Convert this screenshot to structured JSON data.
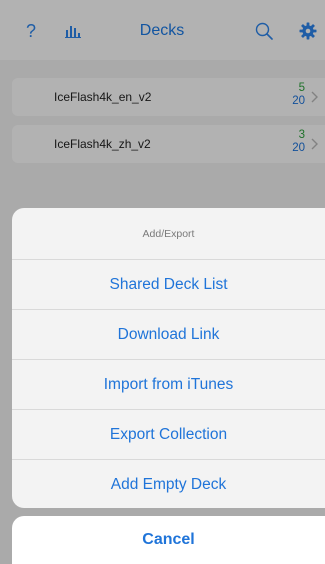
{
  "nav": {
    "help_glyph": "?",
    "title": "Decks",
    "icons": [
      "help-icon",
      "stats-icon",
      "search-icon",
      "gear-icon"
    ]
  },
  "decks": [
    {
      "name": "IceFlash4k_en_v2",
      "due": "5",
      "new": "20"
    },
    {
      "name": "IceFlash4k_zh_v2",
      "due": "3",
      "new": "20"
    }
  ],
  "sheet": {
    "title": "Add/Export",
    "options": [
      "Shared Deck List",
      "Download Link",
      "Import from iTunes",
      "Export Collection",
      "Add Empty Deck"
    ],
    "cancel": "Cancel"
  },
  "colors": {
    "accent": "#1f74d9",
    "due_count": "#2a9d3a",
    "new_count": "#1a6fd6",
    "page_background": "#f4eee6"
  }
}
